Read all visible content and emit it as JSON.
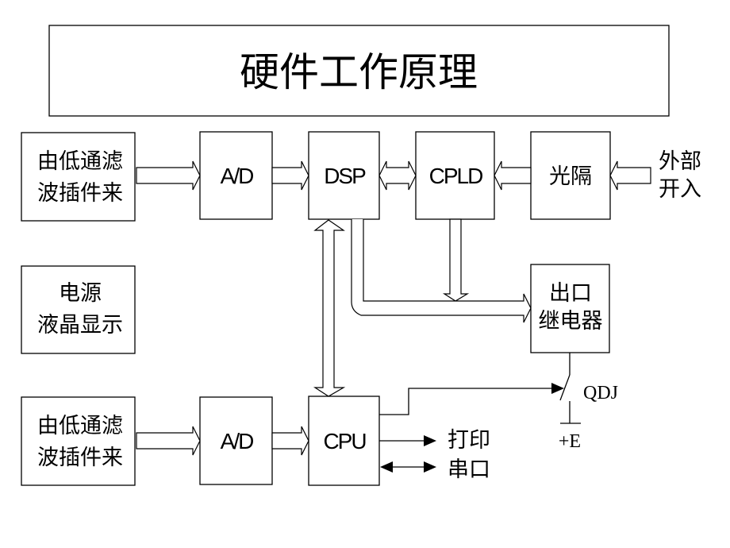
{
  "title": "硬件工作原理",
  "blocks": {
    "filter_top": [
      "由低通滤",
      "波插件来"
    ],
    "ad_top": "A/D",
    "dsp": "DSP",
    "cpld": "CPLD",
    "optocoupler": "光隔",
    "external_input": [
      "外部",
      "开入"
    ],
    "power_lcd": [
      "电源",
      "液晶显示"
    ],
    "relay": [
      "出口",
      "继电器"
    ],
    "filter_bottom": [
      "由低通滤",
      "波插件来"
    ],
    "ad_bottom": "A/D",
    "cpu": "CPU",
    "print": "打印",
    "serial": "串口",
    "switch_label": "QDJ",
    "supply_label": "+E"
  }
}
